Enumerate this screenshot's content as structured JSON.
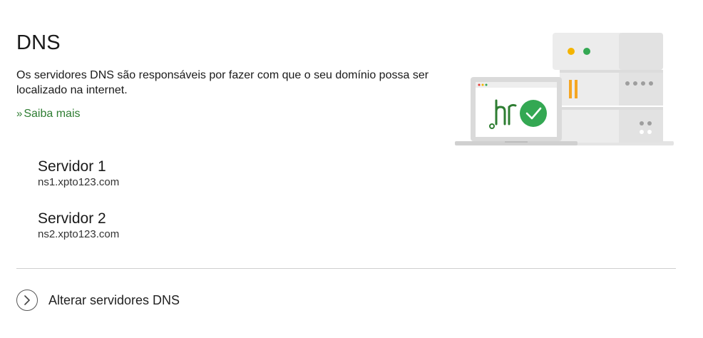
{
  "header": {
    "title": "DNS",
    "description": "Os servidores DNS são responsáveis por fazer com que o seu domínio possa ser localizado na internet.",
    "learn_more_prefix": "»",
    "learn_more_label": "Saiba mais"
  },
  "servers": [
    {
      "name": "Servidor 1",
      "host": "ns1.xpto123.com"
    },
    {
      "name": "Servidor 2",
      "host": "ns2.xpto123.com"
    }
  ],
  "actions": {
    "change_dns_label": "Alterar servidores DNS"
  },
  "illustration": {
    "screen_logo": ".br",
    "icons": [
      "server-rack-icon",
      "laptop-icon",
      "check-circle-icon",
      "chevron-right-icon"
    ]
  },
  "colors": {
    "accent_green": "#2e7d32",
    "check_green": "#34a853",
    "status_yellow": "#f4b400",
    "status_orange": "#f5a623",
    "divider": "#cfcfcf"
  }
}
